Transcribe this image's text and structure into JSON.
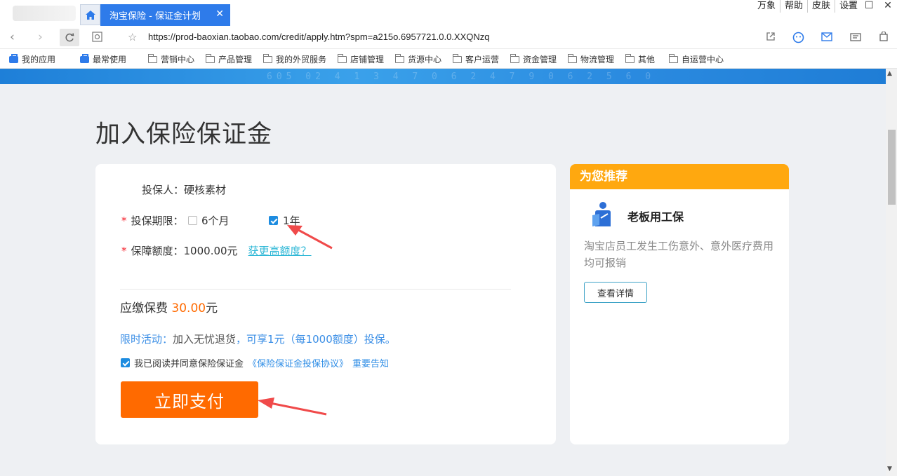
{
  "browser": {
    "tab_title": "淘宝保险 - 保证金计划",
    "tab_close": "✕",
    "window_links": [
      "万象",
      "帮助",
      "皮肤",
      "设置"
    ],
    "window_controls": [
      "—",
      "☐",
      "✕"
    ],
    "url": "https://prod-baoxian.taobao.com/credit/apply.htm?spm=a215o.6957721.0.0.XXQNzq",
    "bookmarks": [
      {
        "label": "我的应用",
        "icon": "briefcase-icon"
      },
      {
        "label": "最常使用",
        "icon": "briefcase-icon"
      },
      {
        "label": "营销中心",
        "icon": "folder-icon"
      },
      {
        "label": "产品管理",
        "icon": "folder-icon"
      },
      {
        "label": "我的外贸服务",
        "icon": "folder-icon"
      },
      {
        "label": "店铺管理",
        "icon": "folder-icon"
      },
      {
        "label": "货源中心",
        "icon": "folder-icon"
      },
      {
        "label": "客户运营",
        "icon": "folder-icon"
      },
      {
        "label": "资金管理",
        "icon": "folder-icon"
      },
      {
        "label": "物流管理",
        "icon": "folder-icon"
      },
      {
        "label": "其他",
        "icon": "folder-icon"
      },
      {
        "label": "自运营中心",
        "icon": "folder-icon"
      }
    ],
    "accent_color": "#2e7bea"
  },
  "page": {
    "title": "加入保险保证金",
    "banner_text": "605 02 4 1 3 4 7 0 6 2 4 7 9 0 6 2 5 6 0"
  },
  "form": {
    "insured_label": "投保人：",
    "insured_value": "硬核素材",
    "required_mark": "*",
    "period_label": "投保期限：",
    "period_options": [
      {
        "label": "6个月",
        "checked": false
      },
      {
        "label": "1年",
        "checked": true
      }
    ],
    "coverage_label": "保障额度：",
    "coverage_value": "1000.00元",
    "coverage_link": "获更高额度？",
    "premium_label": "应缴保费",
    "premium_amount": "30.00",
    "premium_unit": "元",
    "promo_label": "限时活动：",
    "promo_middle": "加入无忧退货",
    "promo_rest": "，可享1元（每1000额度）投保。",
    "agree_checked": true,
    "agree_text": "我已阅读并同意保险保证金",
    "agree_link1": "《保险保证金投保协议》",
    "agree_link2": "重要告知",
    "pay_button": "立即支付",
    "pay_color": "#ff6a00"
  },
  "recommend": {
    "header": "为您推荐",
    "header_color": "#ffa80f",
    "product_name": "老板用工保",
    "product_icon": "worker-icon",
    "product_desc": "淘宝店员工发生工伤意外、意外医疗费用均可报销",
    "detail_button": "查看详情"
  }
}
